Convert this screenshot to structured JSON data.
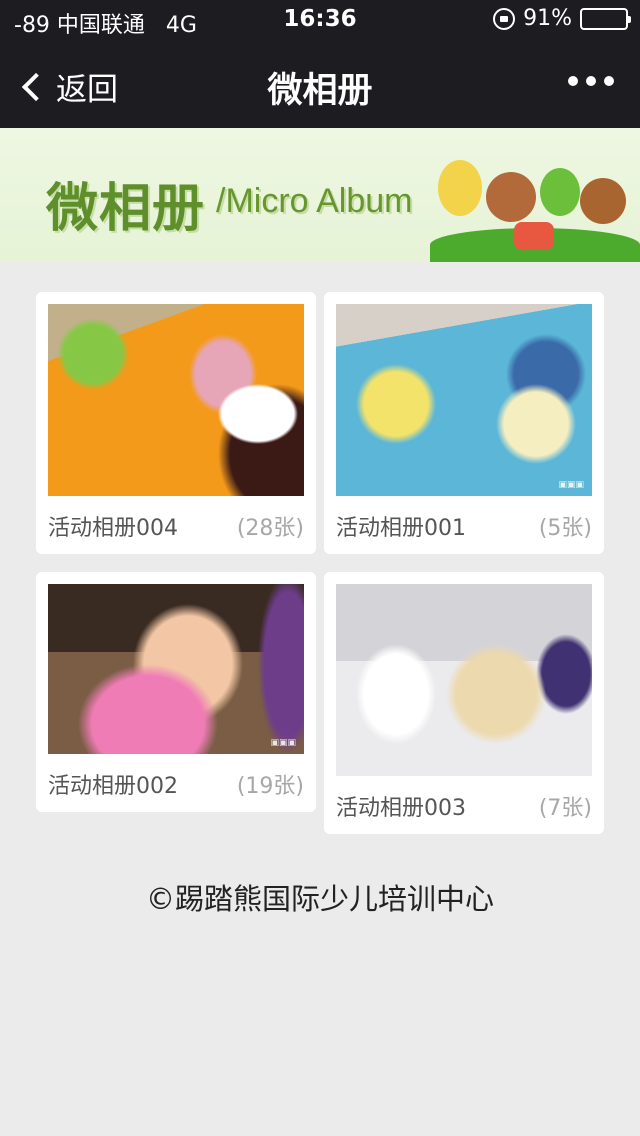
{
  "status_bar": {
    "carrier": "-89 中国联通",
    "network": "4G",
    "time": "16:36",
    "battery": "91%",
    "battery_level": 0.91
  },
  "nav": {
    "back_label": "返回",
    "title": "微相册"
  },
  "banner": {
    "title_cn": "微相册",
    "title_en": "/Micro Album"
  },
  "albums": [
    {
      "name": "活动相册004",
      "count": "(28张)"
    },
    {
      "name": "活动相册001",
      "count": "(5张)"
    },
    {
      "name": "活动相册002",
      "count": "(19张)"
    },
    {
      "name": "活动相册003",
      "count": "(7张)"
    }
  ],
  "footer": "©踢踏熊国际少儿培训中心",
  "colors": {
    "nav_bg": "#1d1c21",
    "page_bg": "#ebebeb",
    "banner_text": "#5f8f2b"
  }
}
